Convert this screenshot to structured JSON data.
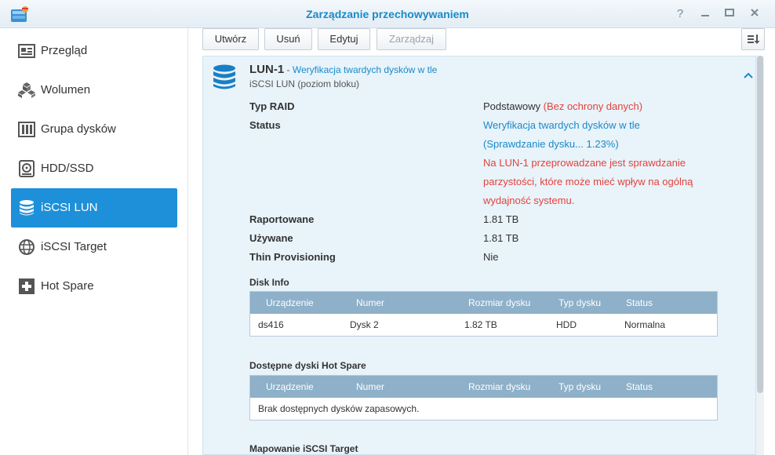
{
  "window": {
    "title": "Zarządzanie przechowywaniem",
    "help": "?",
    "minimize": "_",
    "maximize": "☐",
    "close": "✕"
  },
  "sidebar": {
    "items": [
      {
        "label": "Przegląd",
        "icon": "overview-icon"
      },
      {
        "label": "Wolumen",
        "icon": "volume-icon"
      },
      {
        "label": "Grupa dysków",
        "icon": "disk-group-icon"
      },
      {
        "label": "HDD/SSD",
        "icon": "hdd-icon"
      },
      {
        "label": "iSCSI LUN",
        "icon": "database-icon",
        "active": true
      },
      {
        "label": "iSCSI Target",
        "icon": "globe-icon"
      },
      {
        "label": "Hot Spare",
        "icon": "plus-box-icon"
      }
    ]
  },
  "toolbar": {
    "create": "Utwórz",
    "delete": "Usuń",
    "edit": "Edytuj",
    "manage": "Zarządzaj"
  },
  "lun": {
    "name": "LUN-1",
    "separator": " - ",
    "status_inline": "Weryfikacja twardych dysków w tle",
    "type": "iSCSI LUN (poziom bloku)",
    "raid_label": "Typ RAID",
    "raid_value": "Podstawowy",
    "raid_note": "(Bez ochrony danych)",
    "status_label": "Status",
    "status_line1": "Weryfikacja twardych dysków w tle",
    "status_line2": "(Sprawdzanie dysku... 1.23%)",
    "warning_line1": "Na LUN-1 przeprowadzane jest sprawdzanie",
    "warning_line2": "parzystości, które może mieć wpływ na ogólną",
    "warning_line3": "wydajność systemu.",
    "reported_label": "Raportowane",
    "reported_value": "1.81 TB",
    "used_label": "Używane",
    "used_value": "1.81 TB",
    "thin_label": "Thin Provisioning",
    "thin_value": "Nie"
  },
  "disk_info": {
    "title": "Disk Info",
    "columns": [
      "Urządzenie",
      "Numer",
      "Rozmiar dysku",
      "Typ dysku",
      "Status"
    ],
    "rows": [
      {
        "device": "ds416",
        "number": "Dysk 2",
        "size": "1.82 TB",
        "type": "HDD",
        "status": "Normalna"
      }
    ]
  },
  "hot_spare": {
    "title": "Dostępne dyski Hot Spare",
    "columns": [
      "Urządzenie",
      "Numer",
      "Rozmiar dysku",
      "Typ dysku",
      "Status"
    ],
    "empty": "Brak dostępnych dysków zapasowych."
  },
  "mapping": {
    "title": "Mapowanie iSCSI Target"
  },
  "colors": {
    "accent": "#1e90d9",
    "warning": "#e4423c",
    "ok": "#2ca02c",
    "grid_header": "#8eb0c9"
  }
}
